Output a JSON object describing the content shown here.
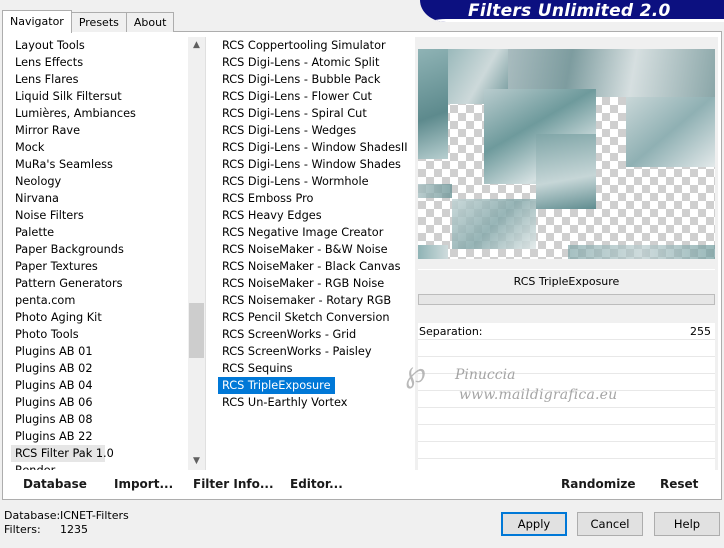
{
  "tabs": [
    "Navigator",
    "Presets",
    "About"
  ],
  "banner_title": "Filters Unlimited 2.0",
  "categories": [
    "Layout Tools",
    "Lens Effects",
    "Lens Flares",
    "Liquid Silk Filtersut",
    "Lumières, Ambiances",
    "Mirror Rave",
    "Mock",
    "MuRa's Seamless",
    "Neology",
    "Nirvana",
    "Noise Filters",
    "Palette",
    "Paper Backgrounds",
    "Paper Textures",
    "Pattern Generators",
    "penta.com",
    "Photo Aging Kit",
    "Photo Tools",
    "Plugins AB 01",
    "Plugins AB 02",
    "Plugins AB 04",
    "Plugins AB 06",
    "Plugins AB 08",
    "Plugins AB 22",
    "RCS Filter Pak 1.0",
    "Render"
  ],
  "selected_category": "RCS Filter Pak 1.0",
  "scroll_up_icon": "▲",
  "scroll_down_icon": "▼",
  "filters": [
    "RCS Coppertooling Simulator",
    "RCS Digi-Lens - Atomic Split",
    "RCS Digi-Lens - Bubble Pack",
    "RCS Digi-Lens - Flower Cut",
    "RCS Digi-Lens - Spiral Cut",
    "RCS Digi-Lens - Wedges",
    "RCS Digi-Lens - Window ShadesII",
    "RCS Digi-Lens - Window Shades",
    "RCS Digi-Lens - Wormhole",
    "RCS Emboss Pro",
    "RCS Heavy Edges",
    "RCS Negative Image Creator",
    "RCS NoiseMaker - B&W Noise",
    "RCS NoiseMaker - Black Canvas",
    "RCS NoiseMaker - RGB Noise",
    "RCS Noisemaker - Rotary RGB",
    "RCS Pencil Sketch Conversion",
    "RCS ScreenWorks - Grid",
    "RCS ScreenWorks - Paisley",
    "RCS Sequins",
    "RCS TripleExposure",
    "RCS Un-Earthly Vortex"
  ],
  "selected_filter": "RCS TripleExposure",
  "filter_title": "RCS TripleExposure",
  "params": [
    {
      "label": "Separation:",
      "value": "255"
    }
  ],
  "toolbar": {
    "database": "Database",
    "import": "Import...",
    "filter_info": "Filter Info...",
    "editor": "Editor...",
    "randomize": "Randomize",
    "reset": "Reset"
  },
  "watermark": {
    "swirl": "℘",
    "name": "Pinuccia",
    "url": "www.maildigrafica.eu"
  },
  "status": {
    "database_label": "Database:",
    "database_value": "ICNET-Filters",
    "filters_label": "Filters:",
    "filters_value": "1235"
  },
  "buttons": {
    "apply": "Apply",
    "cancel": "Cancel",
    "help": "Help"
  }
}
